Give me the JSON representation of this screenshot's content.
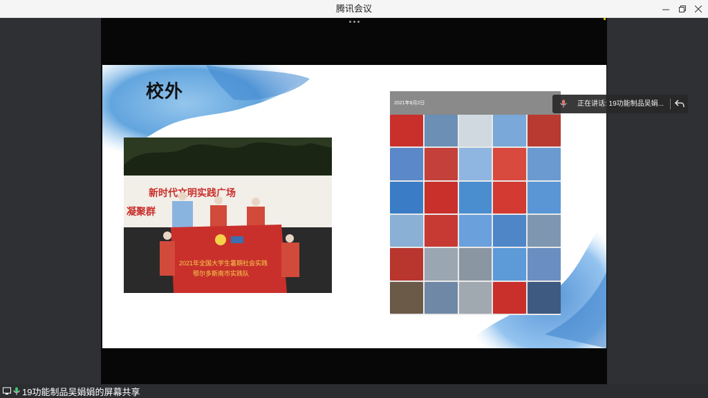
{
  "window": {
    "title": "腾讯会议"
  },
  "slide": {
    "title": "校外",
    "banner_text": "新时代文明实践广场",
    "banner_subtext": "凝聚群",
    "flag_text_line1": "2021年全国大学生暑期社会实践",
    "flag_text_line2": "鄂尔多斯南市实践队",
    "grid_date": "2021年8月2日"
  },
  "speaker": {
    "label": "正在讲话: 19功能制品吴娟..."
  },
  "footer": {
    "share_label": "19功能制品吴娟娟的屏幕共享"
  },
  "colors": {
    "accent_red": "#c9302c",
    "speaker_bg": "#282828",
    "titlebar_bg": "#f5f5f5"
  }
}
